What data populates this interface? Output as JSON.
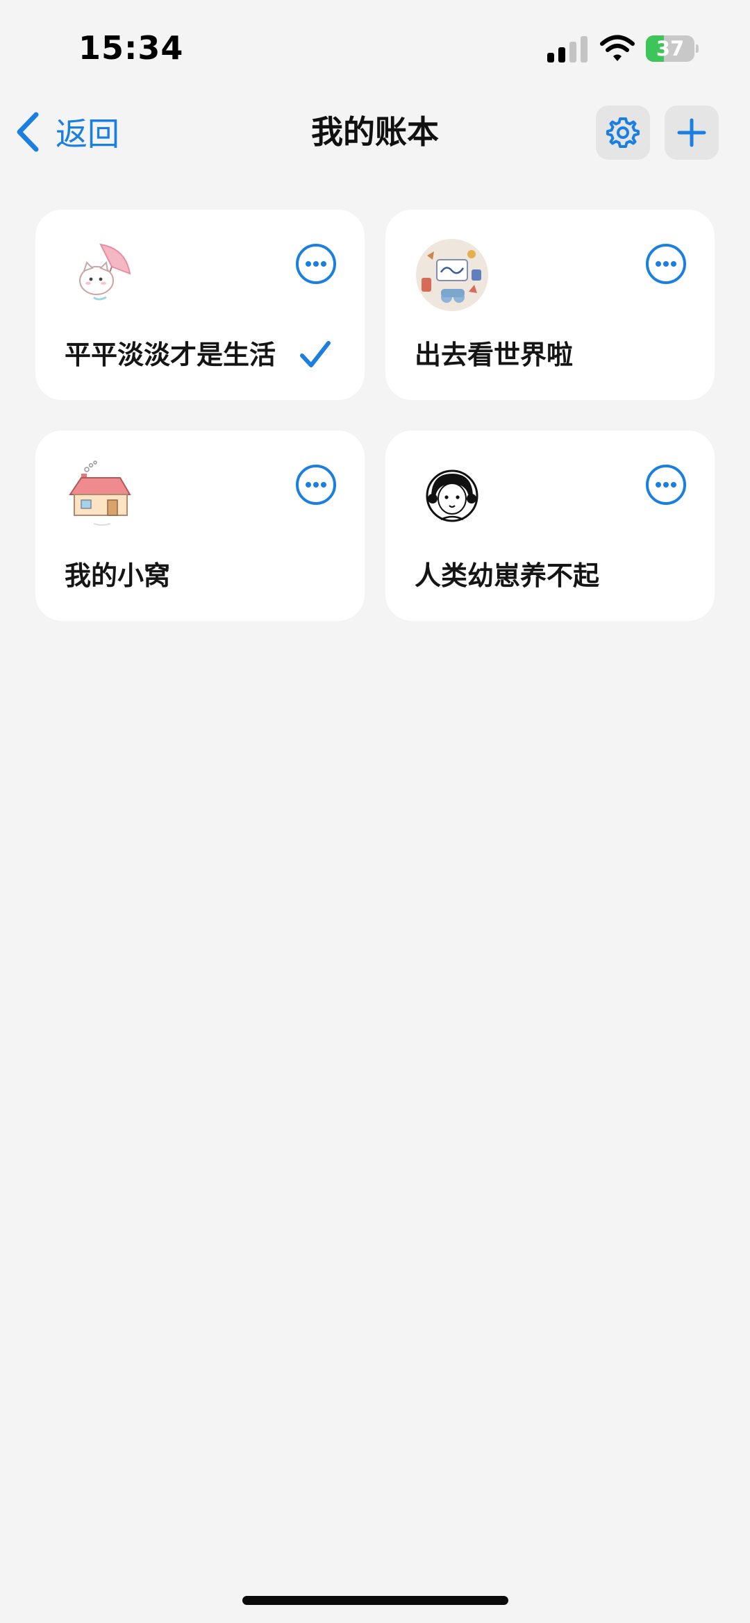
{
  "status_bar": {
    "time": "15:34",
    "battery_level": "37",
    "battery_percent": 37
  },
  "nav": {
    "back_label": "返回",
    "title": "我的账本"
  },
  "books": [
    {
      "name": "平平淡淡才是生活",
      "selected": true,
      "cover": "cat-umbrella-cover"
    },
    {
      "name": "出去看世界啦",
      "selected": false,
      "cover": "travel-cover"
    },
    {
      "name": "我的小窝",
      "selected": false,
      "cover": "house-cover"
    },
    {
      "name": "人类幼崽养不起",
      "selected": false,
      "cover": "girl-portrait-cover"
    }
  ],
  "colors": {
    "accent": "#1a7fe0",
    "background": "#f4f4f4",
    "card": "#ffffff",
    "battery_green": "#3ec55a"
  }
}
